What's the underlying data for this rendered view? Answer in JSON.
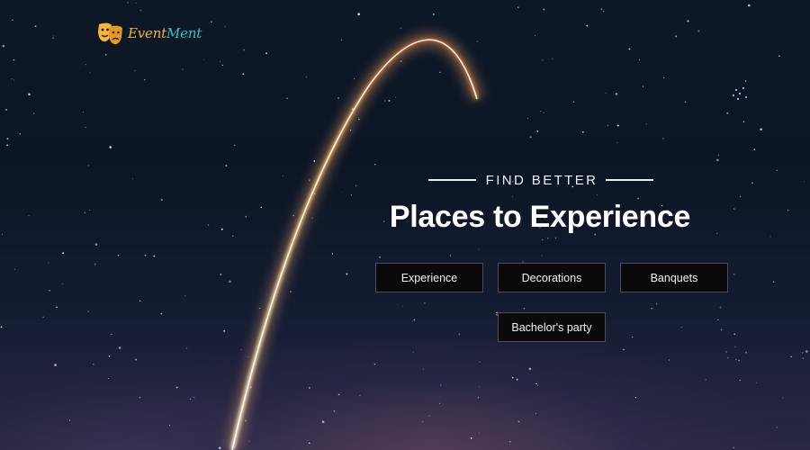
{
  "brand": {
    "name_part1": "Event",
    "name_part2": "Ment",
    "logo_icon": "theater-masks-icon",
    "colors": {
      "primary": "#f0b53a",
      "secondary": "#2ec4c9"
    }
  },
  "hero": {
    "eyebrow": "FIND BETTER",
    "title": "Places to Experience",
    "background": "night-sky-with-rocket-launch-trail"
  },
  "categories": [
    {
      "label": "Experience"
    },
    {
      "label": "Decorations"
    },
    {
      "label": "Banquets"
    },
    {
      "label": "Bachelor's party"
    }
  ]
}
